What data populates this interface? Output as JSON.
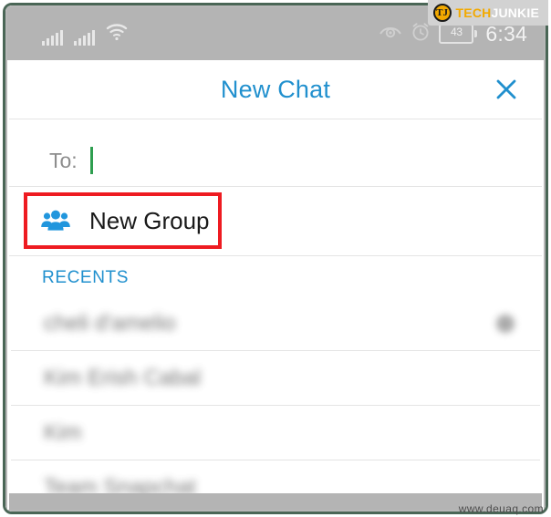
{
  "branding": {
    "logo_mark_text": "TJ",
    "logo_text_part1": "TECH",
    "logo_text_part2": "JUNKIE",
    "logo_accent_color": "#f2a900"
  },
  "status_bar": {
    "signal_icon_1": "signal-bars-icon",
    "signal_icon_2": "signal-bars-icon",
    "wifi_icon": "wifi-icon",
    "eye_icon": "eye-icon",
    "alarm_icon": "alarm-clock-icon",
    "battery_level": "43",
    "time": "6:34",
    "background_color": "#b4b4b4"
  },
  "header": {
    "title": "New Chat",
    "title_color": "#2190ce",
    "close_icon": "close-x-icon"
  },
  "compose": {
    "to_label": "To:",
    "to_value": "",
    "caret_color": "#2e9e4f"
  },
  "new_group": {
    "label": "New Group",
    "icon": "group-people-icon",
    "icon_color": "#2196dd",
    "highlight_color": "#ee1b21"
  },
  "recents": {
    "section_label": "RECENTS",
    "section_label_color": "#2190ce",
    "contacts": [
      {
        "name": "cheli d'amelio",
        "has_badge": true
      },
      {
        "name": "Kim Erish Cabal",
        "has_badge": false
      },
      {
        "name": "Kim",
        "has_badge": false
      },
      {
        "name": "Team Snapchat",
        "has_badge": false
      }
    ]
  },
  "footer": {
    "watermark": "www.deuaq.com"
  }
}
